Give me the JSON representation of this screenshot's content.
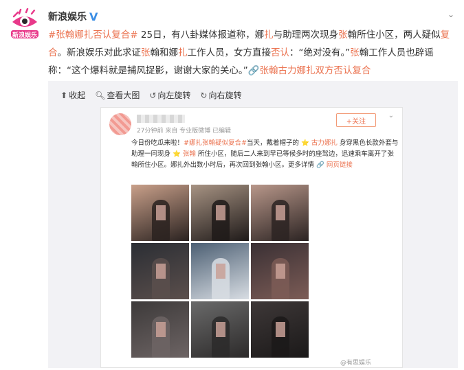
{
  "account": {
    "name": "新浪娱乐",
    "verified_badge": "V",
    "avatar_icon": "sina-ent-eye-logo"
  },
  "post": {
    "text_parts": [
      {
        "t": "#张翰娜扎否认复合#",
        "c": "tag"
      },
      {
        "t": " 25日，有八卦媒体报道称，娜",
        "c": ""
      },
      {
        "t": "扎",
        "c": "hl"
      },
      {
        "t": "与助理两次现身",
        "c": ""
      },
      {
        "t": "张",
        "c": "hl"
      },
      {
        "t": "翰所住小区，两人疑似",
        "c": ""
      },
      {
        "t": "复合",
        "c": "hl"
      },
      {
        "t": "。新浪娱乐对此求证",
        "c": ""
      },
      {
        "t": "张",
        "c": "hl"
      },
      {
        "t": "翰和娜",
        "c": ""
      },
      {
        "t": "扎",
        "c": "hl"
      },
      {
        "t": "工作人员，女方直接",
        "c": ""
      },
      {
        "t": "否认",
        "c": "hl"
      },
      {
        "t": "：“绝对没有。”",
        "c": ""
      },
      {
        "t": "张",
        "c": "hl"
      },
      {
        "t": "翰工作人员也辟谣称：“这个爆料就是捕风捉影，谢谢大家的关心。”",
        "c": ""
      },
      {
        "t": "🔗",
        "c": "lnk-icon"
      },
      {
        "t": "张翰古力娜扎双方否认复合",
        "c": "lnk"
      }
    ]
  },
  "media_toolbar": {
    "collapse": "收起",
    "view_large": "查看大图",
    "rotate_left": "向左旋转",
    "rotate_right": "向右旋转"
  },
  "inner_post": {
    "meta": "27分钟前 来自 专业版微博 已编辑",
    "follow_label": "+关注",
    "text_parts": [
      {
        "t": "今日份吃瓜来啦！",
        "c": ""
      },
      {
        "t": "#娜扎张翰疑似复合#",
        "c": "o"
      },
      {
        "t": "当天，戴着帽子的 ",
        "c": ""
      },
      {
        "t": "⭐ 古力娜扎",
        "c": "o"
      },
      {
        "t": " 身穿黑色长款外套与助理一同现身 ",
        "c": ""
      },
      {
        "t": "⭐ 张翰",
        "c": "o"
      },
      {
        "t": " 所住小区，随后二人来到早已等候多时的座驾边，迅速乘车离开了张翰所住小区。娜扎外出数小时后，再次回到张翰小区。更多详情 ",
        "c": ""
      },
      {
        "t": "🔗 网页链接",
        "c": "o"
      }
    ],
    "watermark": "@有思娱乐"
  },
  "photos": [
    {
      "bg": "#c9a08a",
      "fg": "#2a2220"
    },
    {
      "bg": "#a79383",
      "fg": "#1f1a19"
    },
    {
      "bg": "#b8978a",
      "fg": "#2b2322"
    },
    {
      "bg": "#2b2e34",
      "fg": "#5b4f4c"
    },
    {
      "bg": "#4c5f73",
      "fg": "#d8dde3"
    },
    {
      "bg": "#3a3034",
      "fg": "#7c5c56"
    },
    {
      "bg": "#3d3a3a",
      "fg": "#6d6464"
    },
    {
      "bg": "#6a6a6a",
      "fg": "#2c2a2a"
    },
    {
      "bg": "#3e3838",
      "fg": "#1b1919"
    }
  ],
  "colors": {
    "accent": "#eb7350",
    "link_icon": "#5a8ccf",
    "verified": "#3b8ee5"
  }
}
